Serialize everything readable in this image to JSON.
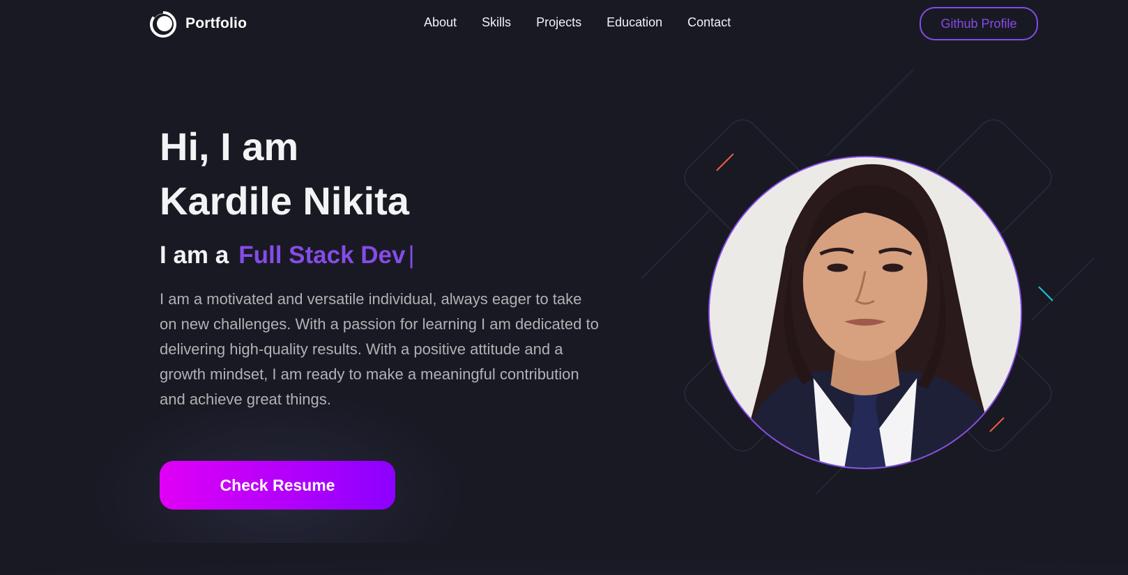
{
  "brand": {
    "name": "Portfolio",
    "logo_icon": "portfolio-logo-icon"
  },
  "nav": {
    "links": [
      "About",
      "Skills",
      "Projects",
      "Education",
      "Contact"
    ],
    "github_label": "Github Profile"
  },
  "hero": {
    "greeting": "Hi, I am",
    "name": "Kardile Nikita",
    "role_prefix": "I am a",
    "role_typed": "Full Stack Dev",
    "cursor": "|",
    "description": "I am a motivated and versatile individual, always eager to take on new challenges. With a passion for learning I am dedicated to delivering high-quality results. With a positive attitude and a growth mindset, I am ready to make a meaningful contribution and achieve great things.",
    "resume_label": "Check Resume",
    "photo_icon": "profile-photo"
  },
  "colors": {
    "background": "#191924",
    "accent": "#854ce6",
    "text_primary": "#f2f3f4",
    "text_secondary": "#b1b2b3",
    "button_gradient_start": "#e000f6",
    "button_gradient_end": "#8c00ff"
  }
}
